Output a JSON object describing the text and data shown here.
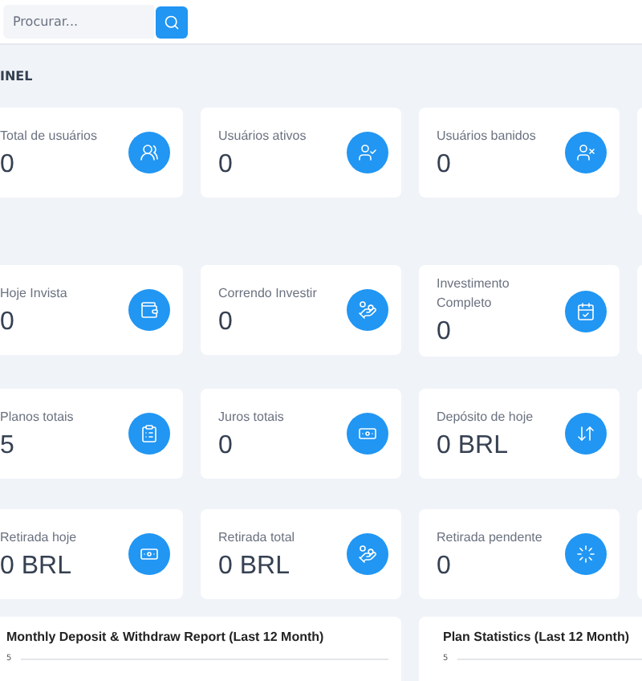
{
  "search": {
    "placeholder": "Procurar..."
  },
  "page_title": "INEL",
  "stat_rows": [
    {
      "cards": [
        {
          "label": "Total de usuários",
          "value": "0"
        },
        {
          "label": "Usuários ativos",
          "value": "0"
        },
        {
          "label": "Usuários banidos",
          "value": "0"
        }
      ]
    },
    {
      "cards": [
        {
          "label": "Hoje Invista",
          "value": "0"
        },
        {
          "label": "Correndo Investir",
          "value": "0"
        },
        {
          "label": "Investimento Completo",
          "value": "0"
        }
      ]
    },
    {
      "cards": [
        {
          "label": "Planos totais",
          "value": "5"
        },
        {
          "label": "Juros totais",
          "value": "0"
        },
        {
          "label": "Depósito de hoje",
          "value": "0 BRL"
        }
      ]
    },
    {
      "cards": [
        {
          "label": "Retirada hoje",
          "value": "0 BRL"
        },
        {
          "label": "Retirada total",
          "value": "0 BRL"
        },
        {
          "label": "Retirada pendente",
          "value": "0"
        }
      ]
    }
  ],
  "charts": [
    {
      "title": "Monthly Deposit & Withdraw Report (Last 12 Month)",
      "tick": "5"
    },
    {
      "title": "Plan Statistics (Last 12 Month)",
      "tick": "5"
    }
  ]
}
